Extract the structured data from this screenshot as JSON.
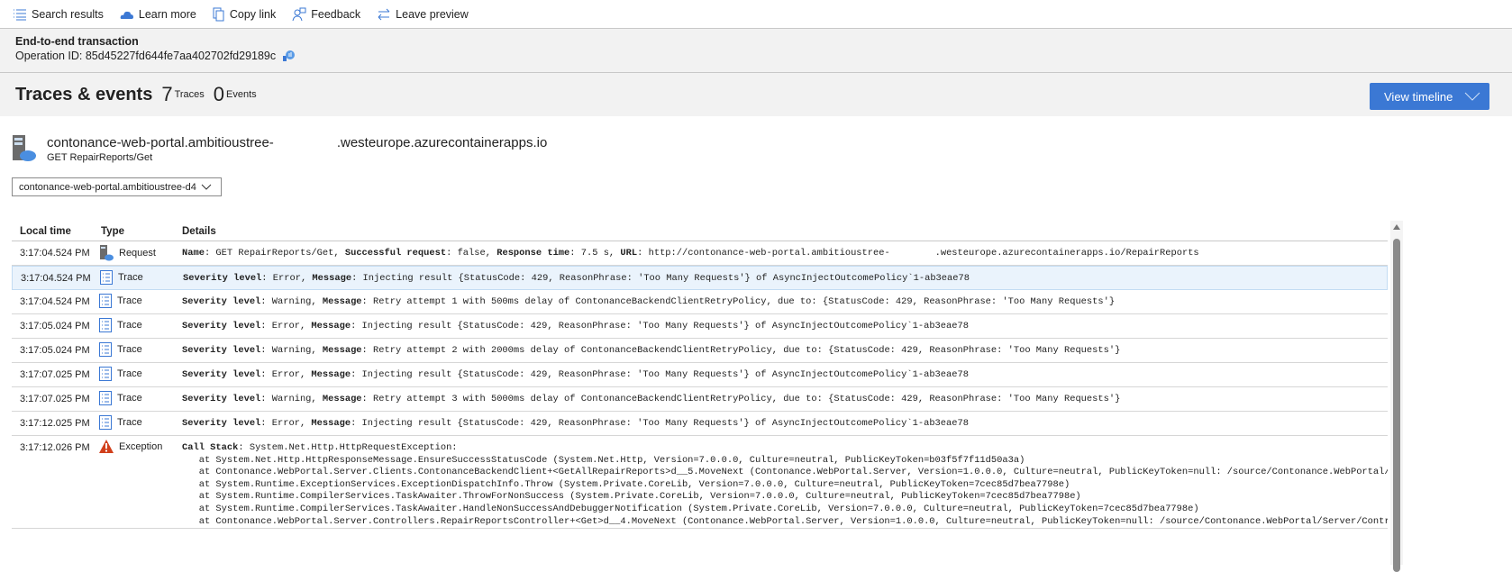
{
  "toolbar": {
    "items": [
      {
        "label": "Search results",
        "icon": "list-icon"
      },
      {
        "label": "Learn more",
        "icon": "cloud-icon"
      },
      {
        "label": "Copy link",
        "icon": "copy-icon"
      },
      {
        "label": "Feedback",
        "icon": "feedback-icon"
      },
      {
        "label": "Leave preview",
        "icon": "switch-icon"
      }
    ]
  },
  "header": {
    "title": "End-to-end transaction",
    "operation_label": "Operation ID: 85d45227fd644fe7aa402702fd29189c"
  },
  "traces": {
    "title": "Traces & events",
    "traces_count": "7",
    "traces_label": "Traces",
    "events_count": "0",
    "events_label": "Events",
    "view_timeline": "View timeline"
  },
  "component": {
    "name_part1": "contonance-web-portal.ambitioustree-",
    "name_part2": ".westeurope.azurecontainerapps.io",
    "operation": "GET RepairReports/Get"
  },
  "selector": {
    "value": "contonance-web-portal.ambitioustree-d4"
  },
  "table": {
    "columns": [
      "Local time",
      "Type",
      "Details"
    ],
    "rows": [
      {
        "time": "3:17:04.524 PM",
        "type": "Request",
        "icon": "request-icon",
        "parts": [
          [
            "Name",
            ": GET RepairReports/Get, "
          ],
          [
            "Successful request",
            ": false, "
          ],
          [
            "Response time",
            ": 7.5 s, "
          ],
          [
            "URL",
            ": http://contonance-web-portal.ambitioustree-        .westeurope.azurecontainerapps.io/RepairReports"
          ]
        ]
      },
      {
        "time": "3:17:04.524 PM",
        "type": "Trace",
        "icon": "trace-icon",
        "selected": true,
        "parts": [
          [
            "Severity level",
            ": Error, "
          ],
          [
            "Message",
            ": Injecting result {StatusCode: 429, ReasonPhrase: 'Too Many Requests'} of AsyncInjectOutcomePolicy`1-ab3eae78"
          ]
        ]
      },
      {
        "time": "3:17:04.524 PM",
        "type": "Trace",
        "icon": "trace-icon",
        "parts": [
          [
            "Severity level",
            ": Warning, "
          ],
          [
            "Message",
            ": Retry attempt 1 with 500ms delay of ContonanceBackendClientRetryPolicy, due to: {StatusCode: 429, ReasonPhrase: 'Too Many Requests'}"
          ]
        ]
      },
      {
        "time": "3:17:05.024 PM",
        "type": "Trace",
        "icon": "trace-icon",
        "parts": [
          [
            "Severity level",
            ": Error, "
          ],
          [
            "Message",
            ": Injecting result {StatusCode: 429, ReasonPhrase: 'Too Many Requests'} of AsyncInjectOutcomePolicy`1-ab3eae78"
          ]
        ]
      },
      {
        "time": "3:17:05.024 PM",
        "type": "Trace",
        "icon": "trace-icon",
        "parts": [
          [
            "Severity level",
            ": Warning, "
          ],
          [
            "Message",
            ": Retry attempt 2 with 2000ms delay of ContonanceBackendClientRetryPolicy, due to: {StatusCode: 429, ReasonPhrase: 'Too Many Requests'}"
          ]
        ]
      },
      {
        "time": "3:17:07.025 PM",
        "type": "Trace",
        "icon": "trace-icon",
        "parts": [
          [
            "Severity level",
            ": Error, "
          ],
          [
            "Message",
            ": Injecting result {StatusCode: 429, ReasonPhrase: 'Too Many Requests'} of AsyncInjectOutcomePolicy`1-ab3eae78"
          ]
        ]
      },
      {
        "time": "3:17:07.025 PM",
        "type": "Trace",
        "icon": "trace-icon",
        "parts": [
          [
            "Severity level",
            ": Warning, "
          ],
          [
            "Message",
            ": Retry attempt 3 with 5000ms delay of ContonanceBackendClientRetryPolicy, due to: {StatusCode: 429, ReasonPhrase: 'Too Many Requests'}"
          ]
        ]
      },
      {
        "time": "3:17:12.025 PM",
        "type": "Trace",
        "icon": "trace-icon",
        "parts": [
          [
            "Severity level",
            ": Error, "
          ],
          [
            "Message",
            ": Injecting result {StatusCode: 429, ReasonPhrase: 'Too Many Requests'} of AsyncInjectOutcomePolicy`1-ab3eae78"
          ]
        ]
      },
      {
        "time": "3:17:12.026 PM",
        "type": "Exception",
        "icon": "warning-icon",
        "parts": [
          [
            "Call Stack",
            ": System.Net.Http.HttpRequestException:\n   at System.Net.Http.HttpResponseMessage.EnsureSuccessStatusCode (System.Net.Http, Version=7.0.0.0, Culture=neutral, PublicKeyToken=b03f5f7f11d50a3a)\n   at Contonance.WebPortal.Server.Clients.ContonanceBackendClient+<GetAllRepairReports>d__5.MoveNext (Contonance.WebPortal.Server, Version=1.0.0.0, Culture=neutral, PublicKeyToken=null: /source/Contonance.WebPortal/Ser\n   at System.Runtime.ExceptionServices.ExceptionDispatchInfo.Throw (System.Private.CoreLib, Version=7.0.0.0, Culture=neutral, PublicKeyToken=7cec85d7bea7798e)\n   at System.Runtime.CompilerServices.TaskAwaiter.ThrowForNonSuccess (System.Private.CoreLib, Version=7.0.0.0, Culture=neutral, PublicKeyToken=7cec85d7bea7798e)\n   at System.Runtime.CompilerServices.TaskAwaiter.HandleNonSuccessAndDebuggerNotification (System.Private.CoreLib, Version=7.0.0.0, Culture=neutral, PublicKeyToken=7cec85d7bea7798e)\n   at Contonance.WebPortal.Server.Controllers.RepairReportsController+<Get>d__4.MoveNext (Contonance.WebPortal.Server, Version=1.0.0.0, Culture=neutral, PublicKeyToken=null: /source/Contonance.WebPortal/Server/Controll"
          ]
        ]
      }
    ]
  },
  "colors": {
    "accent": "#3b78d4",
    "selected_row": "#eaf3fc",
    "exception": "#d13f1b"
  }
}
